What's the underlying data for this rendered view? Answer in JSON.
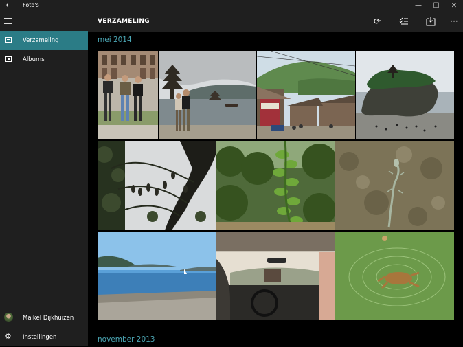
{
  "window": {
    "title": "Foto's",
    "back_icon": "back-arrow-icon",
    "minimize_glyph": "—",
    "maximize_glyph": "☐",
    "close_glyph": "✕"
  },
  "sidebar": {
    "menu_icon": "hamburger-icon",
    "items": [
      {
        "label": "Verzameling",
        "icon": "collection-icon",
        "active": true
      },
      {
        "label": "Albums",
        "icon": "albums-icon",
        "active": false
      }
    ],
    "user": {
      "name": "Maikel Dijkhuizen",
      "icon": "avatar"
    },
    "settings": {
      "label": "Instellingen",
      "icon": "gear-icon"
    }
  },
  "header": {
    "title": "VERZAMELING",
    "actions": [
      "refresh-icon",
      "select-icon",
      "import-icon",
      "more-icon"
    ]
  },
  "sections": [
    {
      "label": "mei 2014"
    },
    {
      "label": "november 2013"
    }
  ],
  "colors": {
    "accent": "#2b7c86",
    "section_label": "#4ba6b4",
    "chrome": "#1f1f1f",
    "background": "#000000"
  }
}
